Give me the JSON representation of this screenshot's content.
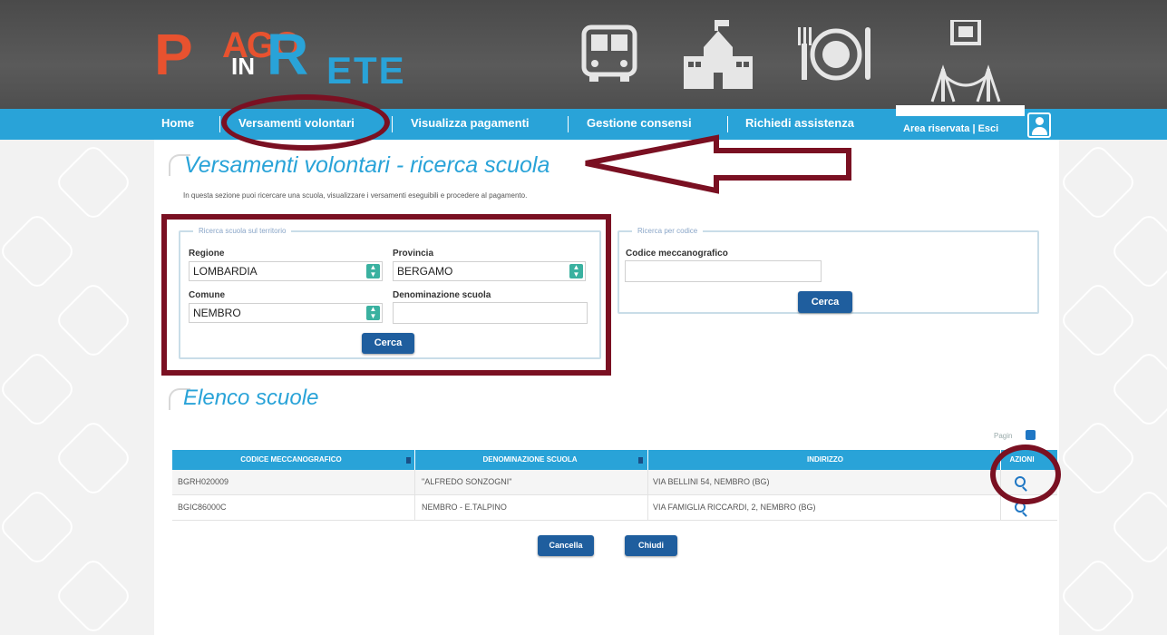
{
  "brand": {
    "logo_p": "P",
    "logo_ago": "AGO",
    "logo_in": "IN",
    "logo_r": "R",
    "logo_ete": "ETE",
    "colors": {
      "nav": "#29a3d8",
      "button": "#1f5e9e",
      "annotation": "#7a1022",
      "accent": "#e8522f"
    }
  },
  "header_icons": [
    "bus-icon",
    "school-icon",
    "dining-icon",
    "museum-icon"
  ],
  "nav": {
    "items": [
      {
        "label": "Home"
      },
      {
        "label": "Versamenti volontari"
      },
      {
        "label": "Visualizza pagamenti"
      },
      {
        "label": "Gestione consensi"
      },
      {
        "label": "Richiedi assistenza"
      }
    ],
    "account_links": "Area riservata | Esci"
  },
  "page": {
    "title": "Versamenti volontari - ricerca scuola",
    "intro": "In questa sezione puoi ricercare una scuola, visualizzare i versamenti eseguibili e procedere al pagamento."
  },
  "territory_search": {
    "legend": "Ricerca scuola sul territorio",
    "regione_label": "Regione",
    "regione_value": "LOMBARDIA",
    "provincia_label": "Provincia",
    "provincia_value": "BERGAMO",
    "comune_label": "Comune",
    "comune_value": "NEMBRO",
    "denominazione_label": "Denominazione scuola",
    "denominazione_value": "",
    "search_button": "Cerca"
  },
  "code_search": {
    "legend": "Ricerca per codice",
    "codice_label": "Codice meccanografico",
    "codice_value": "",
    "search_button": "Cerca"
  },
  "results": {
    "title": "Elenco scuole",
    "pagination_label": "Pagin",
    "columns": [
      "Codice meccanografico",
      "Denominazione scuola",
      "Indirizzo",
      "Azioni"
    ],
    "rows": [
      {
        "codice": "BGRH020009",
        "denominazione": "\"ALFREDO SONZOGNI\"",
        "indirizzo": "VIA BELLINI 54, NEMBRO (BG)"
      },
      {
        "codice": "BGIC86000C",
        "denominazione": "NEMBRO - E.TALPINO",
        "indirizzo": "VIA FAMIGLIA RICCARDI, 2, NEMBRO (BG)"
      }
    ],
    "cancel_button": "Cancella",
    "close_button": "Chiudi"
  }
}
